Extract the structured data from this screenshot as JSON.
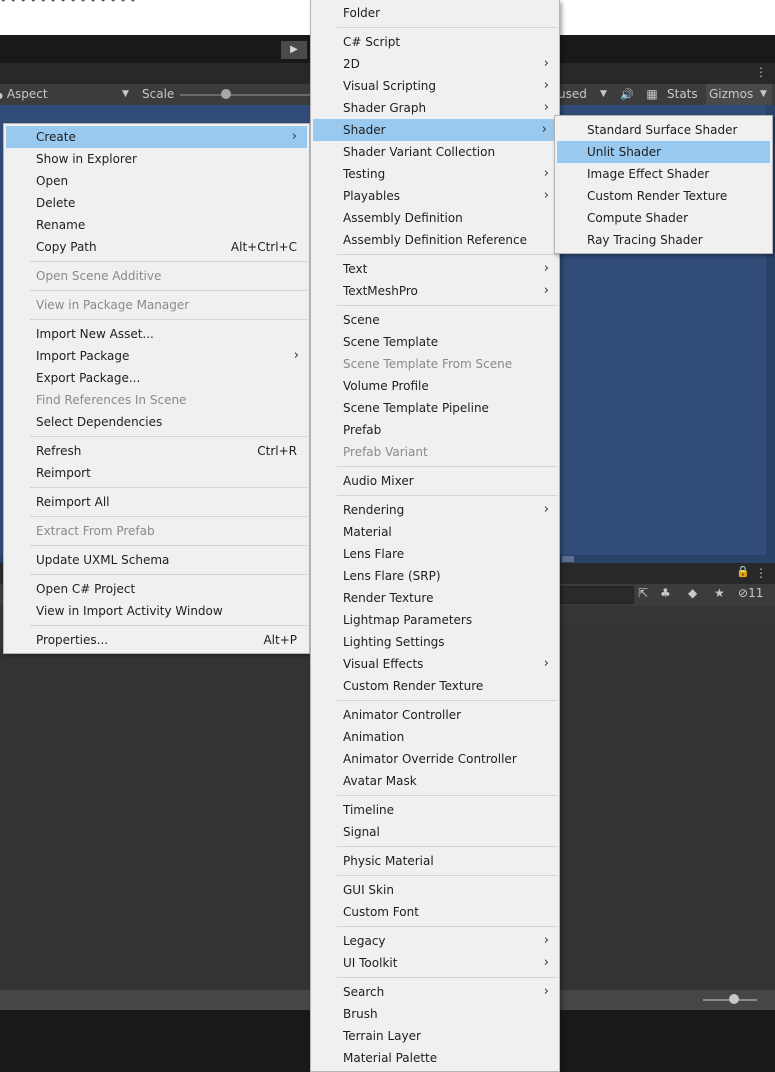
{
  "editor": {
    "top_text": "• • • • • • • • •   •   • • • •",
    "play_icon": "▶",
    "more_icon": "⋮",
    "aspect_label": "Aspect",
    "aspect_prefix": "●",
    "scale_label": "Scale",
    "play_focused_fragment": "used",
    "dropdown_arrow": "▼",
    "mute_icon": "🔊",
    "stats_icon": "▦",
    "stats_label": "Stats",
    "gizmos_label": "Gizmos",
    "lock_icon": "🔒",
    "hidden_count": "11",
    "project_icons": [
      "⇱",
      "♣",
      "◆",
      "★"
    ],
    "hidden_icon": "⊘",
    "colors": {
      "game_view_background": "#314c78",
      "menu_background": "#f0f0f0",
      "menu_selection": "#99c9ef",
      "toolbar_dark": "#191919",
      "panel_gray": "#383838"
    }
  },
  "context_menu": {
    "arrow": "›",
    "groups": [
      [
        {
          "label": "Create",
          "submenu": true,
          "selected": true
        },
        {
          "label": "Show in Explorer"
        },
        {
          "label": "Open"
        },
        {
          "label": "Delete"
        },
        {
          "label": "Rename"
        },
        {
          "label": "Copy Path",
          "shortcut": "Alt+Ctrl+C"
        }
      ],
      [
        {
          "label": "Open Scene Additive",
          "disabled": true
        }
      ],
      [
        {
          "label": "View in Package Manager",
          "disabled": true
        }
      ],
      [
        {
          "label": "Import New Asset..."
        },
        {
          "label": "Import Package",
          "submenu": true
        },
        {
          "label": "Export Package..."
        },
        {
          "label": "Find References In Scene",
          "disabled": true
        },
        {
          "label": "Select Dependencies"
        }
      ],
      [
        {
          "label": "Refresh",
          "shortcut": "Ctrl+R"
        },
        {
          "label": "Reimport"
        }
      ],
      [
        {
          "label": "Reimport All"
        }
      ],
      [
        {
          "label": "Extract From Prefab",
          "disabled": true
        }
      ],
      [
        {
          "label": "Update UXML Schema"
        }
      ],
      [
        {
          "label": "Open C# Project"
        },
        {
          "label": "View in Import Activity Window"
        }
      ],
      [
        {
          "label": "Properties...",
          "shortcut": "Alt+P"
        }
      ]
    ]
  },
  "create_menu": {
    "groups": [
      [
        {
          "label": "Folder"
        }
      ],
      [
        {
          "label": "C# Script"
        },
        {
          "label": "2D",
          "submenu": true
        },
        {
          "label": "Visual Scripting",
          "submenu": true
        },
        {
          "label": "Shader Graph",
          "submenu": true
        },
        {
          "label": "Shader",
          "submenu": true,
          "selected": true
        },
        {
          "label": "Shader Variant Collection"
        },
        {
          "label": "Testing",
          "submenu": true
        },
        {
          "label": "Playables",
          "submenu": true
        },
        {
          "label": "Assembly Definition"
        },
        {
          "label": "Assembly Definition Reference"
        }
      ],
      [
        {
          "label": "Text",
          "submenu": true
        },
        {
          "label": "TextMeshPro",
          "submenu": true
        }
      ],
      [
        {
          "label": "Scene"
        },
        {
          "label": "Scene Template"
        },
        {
          "label": "Scene Template From Scene",
          "disabled": true
        },
        {
          "label": "Volume Profile"
        },
        {
          "label": "Scene Template Pipeline"
        },
        {
          "label": "Prefab"
        },
        {
          "label": "Prefab Variant",
          "disabled": true
        }
      ],
      [
        {
          "label": "Audio Mixer"
        }
      ],
      [
        {
          "label": "Rendering",
          "submenu": true
        },
        {
          "label": "Material"
        },
        {
          "label": "Lens Flare"
        },
        {
          "label": "Lens Flare (SRP)"
        },
        {
          "label": "Render Texture"
        },
        {
          "label": "Lightmap Parameters"
        },
        {
          "label": "Lighting Settings"
        },
        {
          "label": "Visual Effects",
          "submenu": true
        },
        {
          "label": "Custom Render Texture"
        }
      ],
      [
        {
          "label": "Animator Controller"
        },
        {
          "label": "Animation"
        },
        {
          "label": "Animator Override Controller"
        },
        {
          "label": "Avatar Mask"
        }
      ],
      [
        {
          "label": "Timeline"
        },
        {
          "label": "Signal"
        }
      ],
      [
        {
          "label": "Physic Material"
        }
      ],
      [
        {
          "label": "GUI Skin"
        },
        {
          "label": "Custom Font"
        }
      ],
      [
        {
          "label": "Legacy",
          "submenu": true
        },
        {
          "label": "UI Toolkit",
          "submenu": true
        }
      ],
      [
        {
          "label": "Search",
          "submenu": true
        },
        {
          "label": "Brush"
        },
        {
          "label": "Terrain Layer"
        },
        {
          "label": "Material Palette"
        }
      ]
    ]
  },
  "shader_menu": {
    "groups": [
      [
        {
          "label": "Standard Surface Shader"
        },
        {
          "label": "Unlit Shader",
          "selected": true
        },
        {
          "label": "Image Effect Shader"
        },
        {
          "label": "Custom Render Texture"
        },
        {
          "label": "Compute Shader"
        },
        {
          "label": "Ray Tracing Shader"
        }
      ]
    ]
  }
}
